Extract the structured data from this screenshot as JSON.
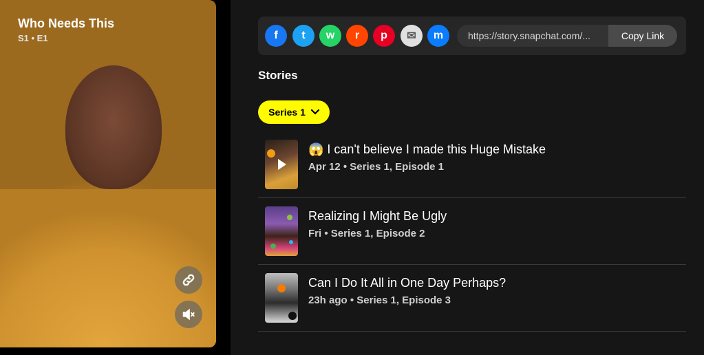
{
  "video": {
    "title": "Who Needs This",
    "subtitle": "S1 • E1",
    "link_icon": "link-icon",
    "mute_icon": "mute-icon"
  },
  "share": {
    "icons": [
      {
        "name": "facebook-icon",
        "glyph": "f",
        "color": "#1877f2"
      },
      {
        "name": "twitter-icon",
        "glyph": "t",
        "color": "#1da1f2"
      },
      {
        "name": "whatsapp-icon",
        "glyph": "w",
        "color": "#25d366"
      },
      {
        "name": "reddit-icon",
        "glyph": "r",
        "color": "#ff4500"
      },
      {
        "name": "pinterest-icon",
        "glyph": "p",
        "color": "#e60023"
      },
      {
        "name": "email-icon",
        "glyph": "✉",
        "color": "#e0e0e0"
      },
      {
        "name": "messenger-icon",
        "glyph": "m",
        "color": "#0a7cff"
      }
    ],
    "link_url": "https://story.snapchat.com/...",
    "copy_label": "Copy Link"
  },
  "stories": {
    "heading": "Stories",
    "series_label": "Series 1",
    "items": [
      {
        "title": "😱 I can't believe I made this Huge Mistake",
        "date": "Apr 12",
        "episode": "Series 1, Episode 1"
      },
      {
        "title": "Realizing I Might Be Ugly",
        "date": "Fri",
        "episode": "Series 1, Episode 2"
      },
      {
        "title": "Can I Do It All in One Day Perhaps?",
        "date": "23h ago",
        "episode": "Series 1, Episode 3"
      }
    ]
  },
  "colors": {
    "accent": "#fffc00",
    "panel": "#262626",
    "background": "#161616"
  }
}
